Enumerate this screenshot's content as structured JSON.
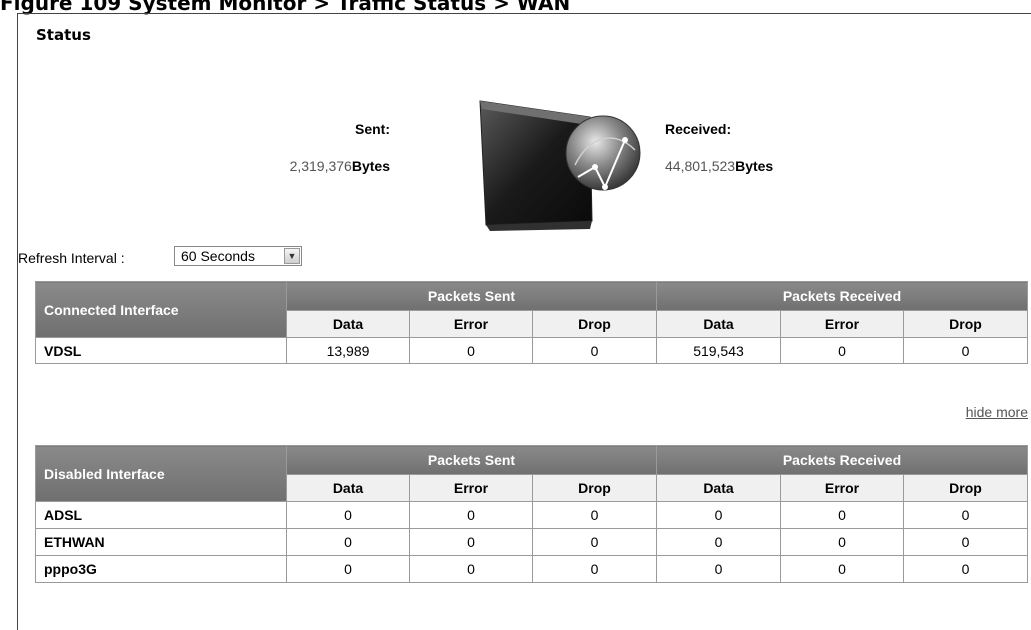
{
  "figure_caption": "Figure 109 System Monitor > Traffic Status > WAN",
  "status": {
    "title": "Status",
    "sent_label": "Sent:",
    "sent_value": "2,319,376",
    "received_label": "Received:",
    "received_value": "44,801,523",
    "unit": "Bytes",
    "device_icon": "router-globe-icon"
  },
  "refresh": {
    "label": "Refresh Interval :",
    "selected": "60 Seconds"
  },
  "connected_table": {
    "interface_header": "Connected Interface",
    "group_sent": "Packets Sent",
    "group_received": "Packets Received",
    "columns": [
      "Data",
      "Error",
      "Drop",
      "Data",
      "Error",
      "Drop"
    ],
    "rows": [
      {
        "name": "VDSL",
        "values": [
          "13,989",
          "0",
          "0",
          "519,543",
          "0",
          "0"
        ]
      }
    ]
  },
  "hide_more_link": "hide more",
  "disabled_table": {
    "interface_header": "Disabled Interface",
    "group_sent": "Packets Sent",
    "group_received": "Packets Received",
    "columns": [
      "Data",
      "Error",
      "Drop",
      "Data",
      "Error",
      "Drop"
    ],
    "rows": [
      {
        "name": "ADSL",
        "values": [
          "0",
          "0",
          "0",
          "0",
          "0",
          "0"
        ]
      },
      {
        "name": "ETHWAN",
        "values": [
          "0",
          "0",
          "0",
          "0",
          "0",
          "0"
        ]
      },
      {
        "name": "pppo3G",
        "values": [
          "0",
          "0",
          "0",
          "0",
          "0",
          "0"
        ]
      }
    ]
  }
}
